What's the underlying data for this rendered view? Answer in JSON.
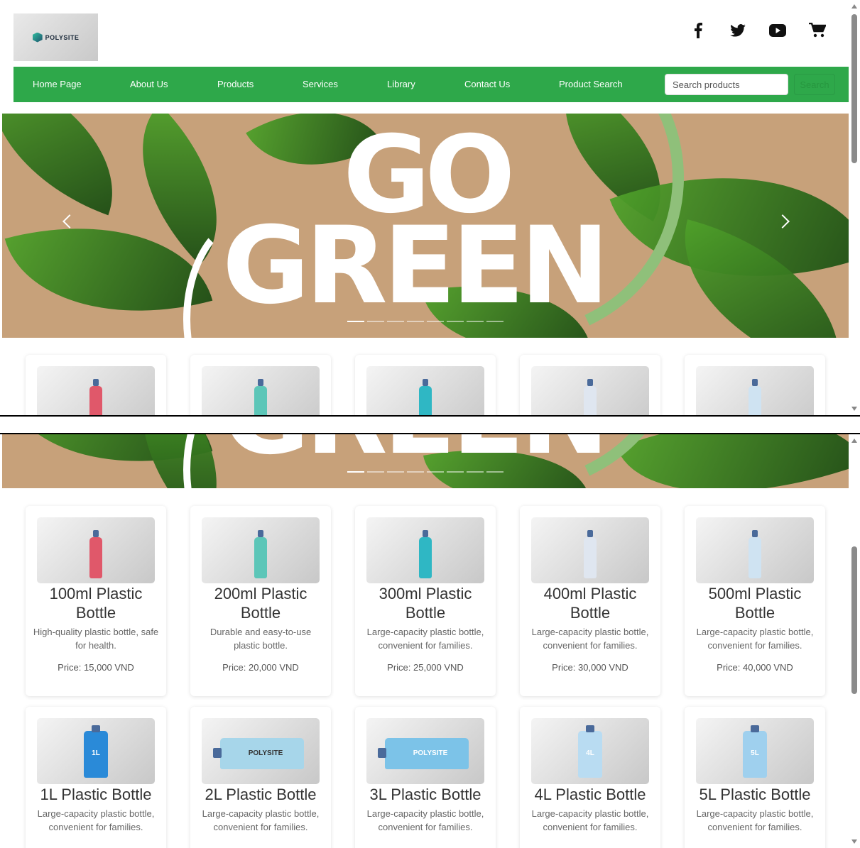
{
  "header": {
    "logo_text": "POLYSITE",
    "socials": [
      "facebook-icon",
      "twitter-icon",
      "youtube-icon",
      "cart-icon"
    ]
  },
  "nav": {
    "items": [
      "Home Page",
      "About Us",
      "Products",
      "Services",
      "Library",
      "Contact Us",
      "Product Search"
    ],
    "search_placeholder": "Search products",
    "search_button": "Search"
  },
  "hero": {
    "line1": "GO",
    "line2": "GREEN",
    "slide_count": 8,
    "active_slide": 1
  },
  "products": [
    {
      "name": "100ml Plastic Bottle",
      "desc": "High-quality plastic bottle, safe for health.",
      "price": "Price: 15,000 VND",
      "bottle_color": "#e0586a"
    },
    {
      "name": "200ml Plastic Bottle",
      "desc": "Durable and easy-to-use plastic bottle.",
      "price": "Price: 20,000 VND",
      "bottle_color": "#5cc6b8"
    },
    {
      "name": "300ml Plastic Bottle",
      "desc": "Large-capacity plastic bottle, convenient for families.",
      "price": "Price: 25,000 VND",
      "bottle_color": "#2fb7c4"
    },
    {
      "name": "400ml Plastic Bottle",
      "desc": "Large-capacity plastic bottle, convenient for families.",
      "price": "Price: 30,000 VND",
      "bottle_color": "#dfe6f0"
    },
    {
      "name": "500ml Plastic Bottle",
      "desc": "Large-capacity plastic bottle, convenient for families.",
      "price": "Price: 40,000 VND",
      "bottle_color": "#cfe3f2"
    },
    {
      "name": "1L Plastic Bottle",
      "desc": "Large-capacity plastic bottle, convenient for families.",
      "price": "",
      "bottle_color": "#2a8ad8",
      "label": "1L"
    },
    {
      "name": "2L Plastic Bottle",
      "desc": "Large-capacity plastic bottle, convenient for families.",
      "price": "",
      "bottle_color": "#a7d6ea",
      "label": "POLYSITE"
    },
    {
      "name": "3L Plastic Bottle",
      "desc": "Large-capacity plastic bottle, convenient for families.",
      "price": "",
      "bottle_color": "#7cc3e8",
      "label": "POLYSITE"
    },
    {
      "name": "4L Plastic Bottle",
      "desc": "Large-capacity plastic bottle, convenient for families.",
      "price": "",
      "bottle_color": "#b9dcf2",
      "label": "4L"
    },
    {
      "name": "5L Plastic Bottle",
      "desc": "Large-capacity plastic bottle, convenient for families.",
      "price": "",
      "bottle_color": "#9fd0ee",
      "label": "5L"
    }
  ]
}
